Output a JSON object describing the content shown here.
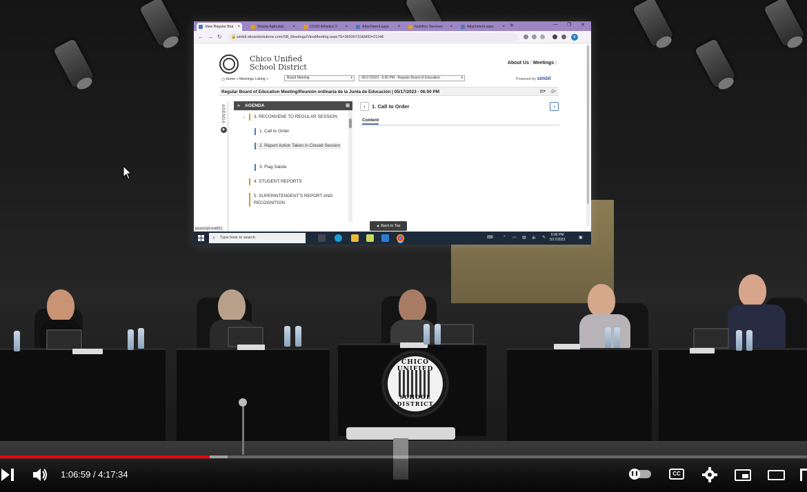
{
  "browser": {
    "tabs": [
      {
        "label": "View Regular Boa",
        "color": "#4a7ab8",
        "active": true
      },
      {
        "label": "Shasta Agthulatc",
        "color": "#e0a11b"
      },
      {
        "label": "CUSD Athletics 2",
        "color": "#e0a11b"
      },
      {
        "label": "Attachment.aspx",
        "color": "#4a7ab8"
      },
      {
        "label": "Nutrition Services",
        "color": "#e0a11b"
      },
      {
        "label": "Attachment.aspx",
        "color": "#4a7ab8"
      }
    ],
    "url": "simbli.eboardsolutions.com/SB_Meetings/ViewMeeting.aspx?S=36030732&MID=21148",
    "profile_initial": "e"
  },
  "site": {
    "org_line1": "Chico Unified",
    "org_line2": "School District",
    "about_link": "About Us",
    "meetings_link": "Meetings",
    "breadcrumb_home": "Home",
    "breadcrumb_meetings": "Meetings Listing",
    "board_select": "Board Meeting",
    "meeting_select": "05/17/2023 - 6:00 PM - Regular Board of Education",
    "powered_by": "Powered by",
    "powered_brand": "simbli",
    "meeting_title": "Regular Board of Education Meeting/Reunión ordinaria de la Junta de Educación | 05/17/2023 - 06:00 PM",
    "vertical_tab": "AGENDA",
    "agenda_header": "AGENDA",
    "agenda_items": [
      {
        "label": "3. RECONVENE TO REGULAR SESSION",
        "level": 1
      },
      {
        "label": "1. Call to Order",
        "level": 2
      },
      {
        "label": "2. Report Action Taken in Closed Session",
        "level": 2
      },
      {
        "label": "3. Flag Salute",
        "level": 2
      },
      {
        "label": "4. STUDENT REPORTS",
        "level": 1
      },
      {
        "label": "5. SUPERINTENDENT'S REPORT AND RECOGNITION",
        "level": 1
      }
    ],
    "detail_title": "1. Call to Order",
    "detail_tab": "Content",
    "status_text": "javascript:void(0);",
    "back_to_top": "Back to Top"
  },
  "taskbar": {
    "search_placeholder": "Type here to search",
    "time": "6:06 PM",
    "date": "5/17/2023"
  },
  "scene": {
    "seal_top": "CHICO UNIFIED",
    "seal_bottom": "SCHOOL DISTRICT"
  },
  "player": {
    "time_display": "1:06:59 / 4:17:34",
    "cc_label": "CC",
    "progress_fraction": 0.26
  }
}
